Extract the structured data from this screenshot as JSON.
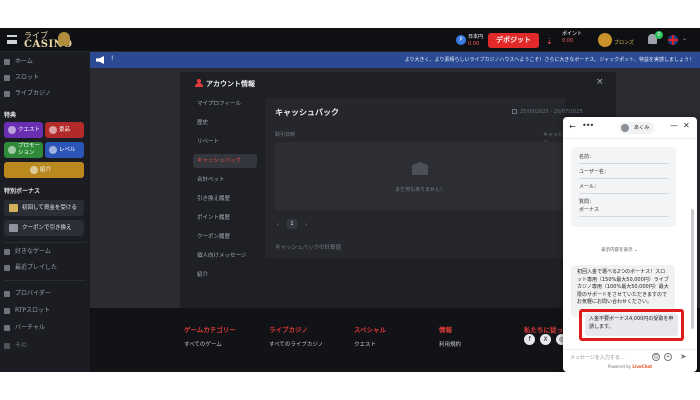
{
  "header": {
    "logo_top": "ライブ",
    "logo_main": "CASINO",
    "account_icon": "P",
    "lang_label": "日本円",
    "lang_value": "0.00",
    "deposit_label": "デポジット",
    "points_label": "ポイント",
    "points_value": "0.00",
    "rank_label": "ブロンズ",
    "notification_count": "0"
  },
  "sidebar": {
    "items_top": [
      {
        "label": "ホーム",
        "icon": "home-icon"
      },
      {
        "label": "スロット",
        "icon": "slot-icon"
      },
      {
        "label": "ライブカジノ",
        "icon": "live-icon"
      }
    ],
    "features_heading": "特典",
    "tiles": [
      "クエスト",
      "景品",
      "プロモーション",
      "レベル",
      "紹介"
    ],
    "bonus_heading": "特別ボーナス",
    "bonus_buttons": [
      "初回して資金を受ける",
      "クーポンで引き換え"
    ],
    "items_bottom": [
      {
        "label": "好きなゲーム",
        "icon": "heart-icon"
      },
      {
        "label": "最近プレイした",
        "icon": "history-icon"
      },
      {
        "label": "プロバイダー",
        "icon": "provider-icon"
      },
      {
        "label": "RTPスロット",
        "icon": "rtp-icon"
      },
      {
        "label": "バーチャル",
        "icon": "virtual-icon"
      },
      {
        "label": "その",
        "icon": "more-icon"
      }
    ]
  },
  "announcement": {
    "badge": "!",
    "text": "より大きく、より素晴らしいライブカジノハウスへようこそ！さらに大きなボーナス、ジャックポット、特益を実感しましょう！"
  },
  "modal": {
    "title": "アカウント情報",
    "menu": [
      "マイプロフィール",
      "歴史",
      "リベート",
      "キャッシュバック",
      "合計ベット",
      "引き換え履歴",
      "ポイント履歴",
      "クーポン履歴",
      "個人向けメッセージ",
      "紹介"
    ],
    "active_index": 3,
    "panel_title": "キャッシュバック",
    "date_range": "25/05/2025 - 25/07/2025",
    "col_left": "取引日時",
    "col_right": "キャッシュ",
    "empty_text": "まだ何もありません！",
    "pager": {
      "prev": "‹",
      "current": "1",
      "next": "›"
    },
    "note": "キャッシュバックの計算値"
  },
  "footer": {
    "columns": [
      {
        "heading": "ゲームカテゴリー",
        "link": "すべてのゲーム"
      },
      {
        "heading": "ライブカジノ",
        "link": "すべてのライブカジノ"
      },
      {
        "heading": "スペシャル",
        "link": "クエスト"
      },
      {
        "heading": "情報",
        "link": "利用規約"
      },
      {
        "heading": "私たちに従ってください",
        "link": ""
      }
    ],
    "social": [
      "f",
      "X",
      "◎",
      "▶",
      "✈"
    ]
  },
  "chat": {
    "agent_name": "あくみ",
    "form_lines": [
      "名前：",
      "ユーザー名：",
      "メール：",
      "質問：",
      "ボーナス"
    ],
    "show_all": "表示内容を表示 ⌄",
    "incoming": "初回入金で選べる2つのボーナス！スロット専用（150%最大50,000円）ライブカジノ専用（100%最大50,000円）最大限のサポートをさせていただきますのでお気軽にお問い合わせください。",
    "outgoing": "入金不要ボーナス4,000円の受取を申請します。",
    "input_placeholder": "メッセージを入力する...",
    "powered_prefix": "Powered by",
    "powered_brand": "LiveChat"
  },
  "colors": {
    "accent_red": "#e22a2a",
    "announce_blue": "#2a4a93",
    "highlight_box": "#e01a1a"
  }
}
